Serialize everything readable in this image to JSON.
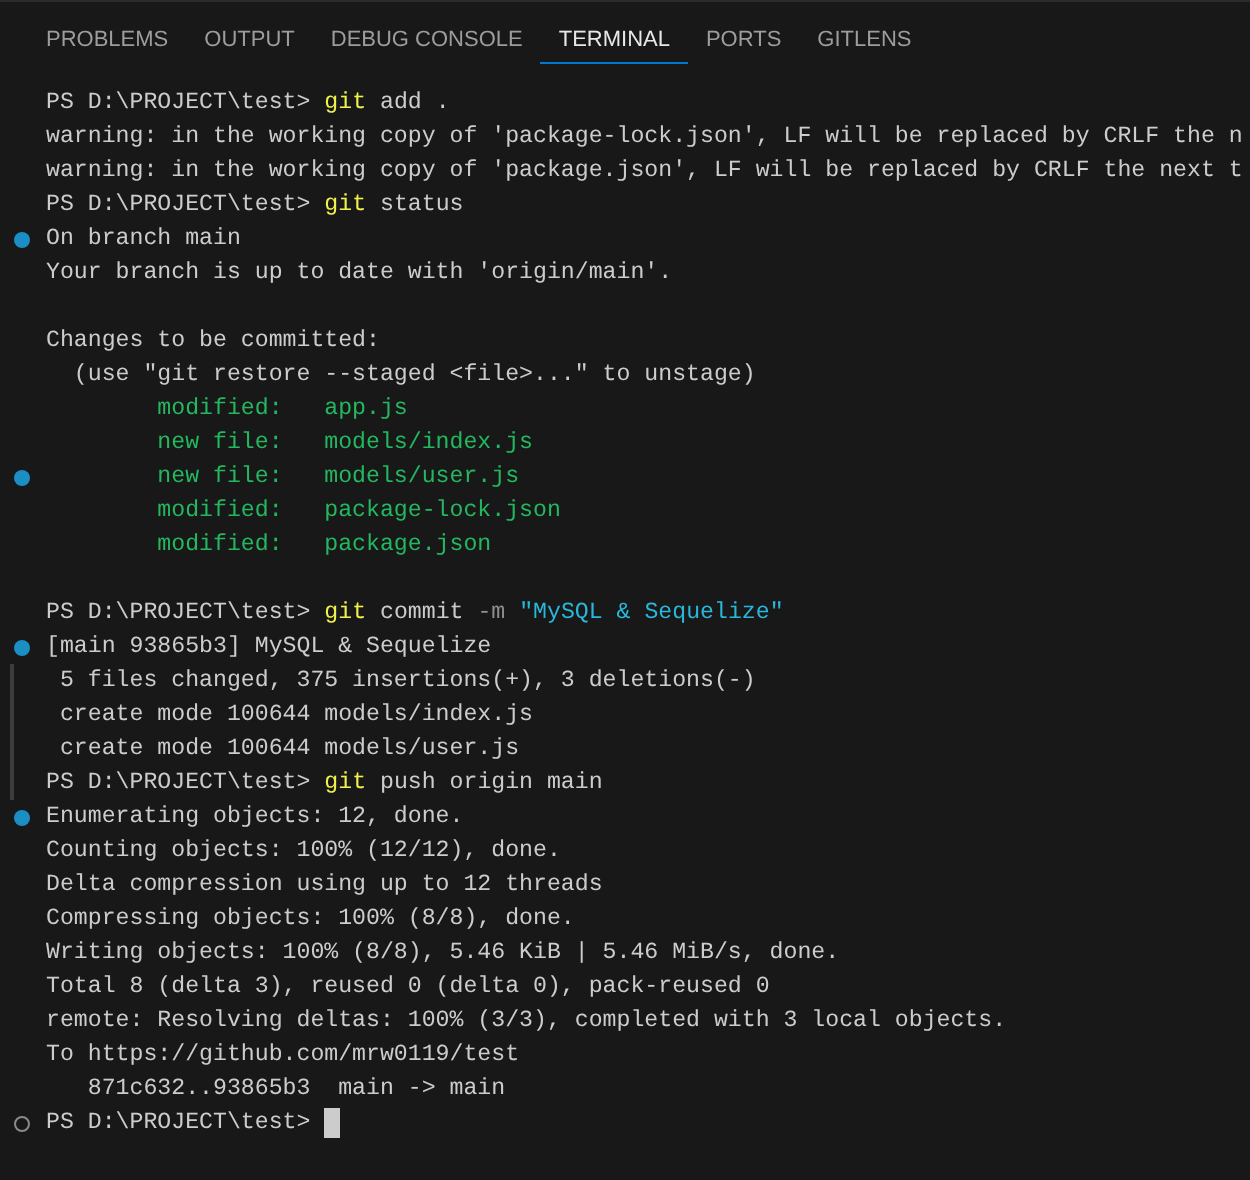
{
  "tabs": [
    {
      "label": "PROBLEMS",
      "selected": false
    },
    {
      "label": "OUTPUT",
      "selected": false
    },
    {
      "label": "DEBUG CONSOLE",
      "selected": false
    },
    {
      "label": "TERMINAL",
      "selected": true
    },
    {
      "label": "PORTS",
      "selected": false
    },
    {
      "label": "GITLENS",
      "selected": false
    }
  ],
  "terminal": {
    "lines": [
      {
        "kind": "text",
        "segments": [
          {
            "kind": "plain",
            "text": "PS D:\\PROJECT\\test> "
          },
          {
            "kind": "command",
            "text": "git"
          },
          {
            "kind": "plain",
            "text": " add ."
          }
        ]
      },
      {
        "kind": "text",
        "segments": [
          {
            "kind": "plain",
            "text": "warning: in the working copy of 'package-lock.json', LF will be replaced by CRLF the n"
          }
        ]
      },
      {
        "kind": "text",
        "segments": [
          {
            "kind": "plain",
            "text": "warning: in the working copy of 'package.json', LF will be replaced by CRLF the next t"
          }
        ]
      },
      {
        "kind": "text",
        "segments": [
          {
            "kind": "plain",
            "text": "PS D:\\PROJECT\\test> "
          },
          {
            "kind": "command",
            "text": "git"
          },
          {
            "kind": "plain",
            "text": " status"
          }
        ]
      },
      {
        "kind": "text",
        "decoration": {
          "kind": "success"
        },
        "segments": [
          {
            "kind": "plain",
            "text": "On branch main"
          }
        ]
      },
      {
        "kind": "text",
        "segments": [
          {
            "kind": "plain",
            "text": "Your branch is up to date with 'origin/main'."
          }
        ]
      },
      {
        "kind": "blank"
      },
      {
        "kind": "text",
        "segments": [
          {
            "kind": "plain",
            "text": "Changes to be committed:"
          }
        ]
      },
      {
        "kind": "text",
        "segments": [
          {
            "kind": "plain",
            "text": "  (use \"git restore --staged <file>...\" to unstage)"
          }
        ]
      },
      {
        "kind": "staged",
        "segments": [
          {
            "kind": "staged",
            "text": "modified:   app.js"
          }
        ]
      },
      {
        "kind": "staged",
        "segments": [
          {
            "kind": "staged",
            "text": "new file:   models/index.js"
          }
        ]
      },
      {
        "kind": "staged",
        "decoration": {
          "kind": "success"
        },
        "segments": [
          {
            "kind": "staged",
            "text": "new file:   models/user.js"
          }
        ]
      },
      {
        "kind": "staged",
        "segments": [
          {
            "kind": "staged",
            "text": "modified:   package-lock.json"
          }
        ]
      },
      {
        "kind": "staged",
        "segments": [
          {
            "kind": "staged",
            "text": "modified:   package.json"
          }
        ]
      },
      {
        "kind": "blank"
      },
      {
        "kind": "text",
        "segments": [
          {
            "kind": "plain",
            "text": "PS D:\\PROJECT\\test> "
          },
          {
            "kind": "command",
            "text": "git"
          },
          {
            "kind": "plain",
            "text": " commit "
          },
          {
            "kind": "flag",
            "text": "-m"
          },
          {
            "kind": "string",
            "text": " \"MySQL & Sequelize\""
          }
        ]
      },
      {
        "kind": "text",
        "decoration": {
          "kind": "success"
        },
        "segments": [
          {
            "kind": "plain",
            "text": "[main 93865b3] MySQL & Sequelize"
          }
        ]
      },
      {
        "kind": "text",
        "decoration": {
          "kind": "bar"
        },
        "segments": [
          {
            "kind": "plain",
            "text": " 5 files changed, 375 insertions(+), 3 deletions(-)"
          }
        ]
      },
      {
        "kind": "text",
        "decoration": {
          "kind": "bar"
        },
        "segments": [
          {
            "kind": "plain",
            "text": " create mode 100644 models/index.js"
          }
        ]
      },
      {
        "kind": "text",
        "decoration": {
          "kind": "bar"
        },
        "segments": [
          {
            "kind": "plain",
            "text": " create mode 100644 models/user.js"
          }
        ]
      },
      {
        "kind": "text",
        "decoration": {
          "kind": "bar"
        },
        "segments": [
          {
            "kind": "plain",
            "text": "PS D:\\PROJECT\\test> "
          },
          {
            "kind": "command",
            "text": "git"
          },
          {
            "kind": "plain",
            "text": " push origin main"
          }
        ]
      },
      {
        "kind": "text",
        "decoration": {
          "kind": "success"
        },
        "segments": [
          {
            "kind": "plain",
            "text": "Enumerating objects: 12, done."
          }
        ]
      },
      {
        "kind": "text",
        "segments": [
          {
            "kind": "plain",
            "text": "Counting objects: 100% (12/12), done."
          }
        ]
      },
      {
        "kind": "text",
        "segments": [
          {
            "kind": "plain",
            "text": "Delta compression using up to 12 threads"
          }
        ]
      },
      {
        "kind": "text",
        "segments": [
          {
            "kind": "plain",
            "text": "Compressing objects: 100% (8/8), done."
          }
        ]
      },
      {
        "kind": "text",
        "segments": [
          {
            "kind": "plain",
            "text": "Writing objects: 100% (8/8), 5.46 KiB | 5.46 MiB/s, done."
          }
        ]
      },
      {
        "kind": "text",
        "segments": [
          {
            "kind": "plain",
            "text": "Total 8 (delta 3), reused 0 (delta 0), pack-reused 0"
          }
        ]
      },
      {
        "kind": "text",
        "segments": [
          {
            "kind": "plain",
            "text": "remote: Resolving deltas: 100% (3/3), completed with 3 local objects."
          }
        ]
      },
      {
        "kind": "text",
        "segments": [
          {
            "kind": "plain",
            "text": "To https://github.com/mrw0119/test"
          }
        ]
      },
      {
        "kind": "text",
        "segments": [
          {
            "kind": "plain",
            "text": "   871c632..93865b3  main -> main"
          }
        ]
      },
      {
        "kind": "prompt",
        "decoration": {
          "kind": "pending"
        },
        "segments": [
          {
            "kind": "plain",
            "text": "PS D:\\PROJECT\\test> "
          }
        ]
      }
    ]
  }
}
